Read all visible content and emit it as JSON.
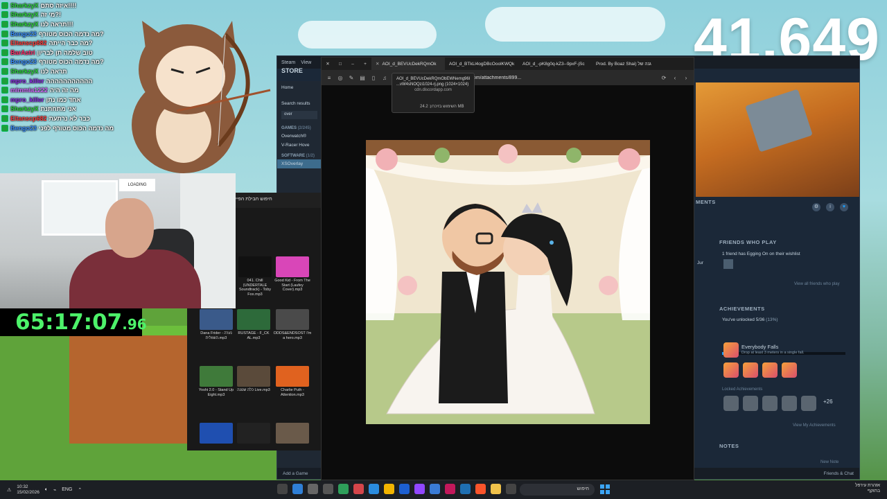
{
  "viewer_count": "41,649",
  "timer": {
    "main": "65:17:07",
    "fraction": ".96"
  },
  "chat": [
    {
      "user": "SharkzyX",
      "color": "#2bd63a",
      "msg": "איזה סתם!!!!"
    },
    {
      "user": "SharkzyX",
      "color": "#2bd63a",
      "msg": "מי זה?!"
    },
    {
      "user": "SharkzyX",
      "color": "#2bd63a",
      "msg": "תראה לנו!!!"
    },
    {
      "user": "Bengo23",
      "color": "#3a8fff",
      "msg": "מה נדמה הכוס מטורף?"
    },
    {
      "user": "Eltanscp682",
      "color": "#ff3b3b",
      "msg": "מה כבר הייתה?"
    },
    {
      "user": "BarAstri",
      "color": "#ff2d6a",
      "msg": "טוב שלמה תן לבריון"
    },
    {
      "user": "Bengo23",
      "color": "#3a8fff",
      "msg": "מה נדמה הכוס מטורף?"
    },
    {
      "user": "SharkzyX",
      "color": "#2bd63a",
      "msg": "תראה לנו"
    },
    {
      "user": "mpro_killer",
      "color": "#8a2be2",
      "msg": "ההההההההההה"
    },
    {
      "user": "mimmia1222",
      "color": "#d36bff",
      "msg": "מה זה היה"
    },
    {
      "user": "mpro_killer",
      "color": "#8a2be2",
      "msg": "אחד כמו נתן"
    },
    {
      "user": "SharkzyX",
      "color": "#2bd63a",
      "msg": "אני מתחתנת"
    },
    {
      "user": "Eltanscp682",
      "color": "#ff3b3b",
      "msg": "כבר לא נרתעת"
    },
    {
      "user": "Bengo23",
      "color": "#3a8fff",
      "msg": "מה נדמה הכוס מטורף לפני"
    }
  ],
  "webcam": {
    "sign": "LOADING"
  },
  "steam": {
    "title_items": [
      "Steam",
      "View"
    ],
    "store_label": "STORE",
    "nav_home": "Home",
    "search_results": "Search results",
    "search_value": "over",
    "games_header": "GAMES",
    "games_count": "(2/245)",
    "games": [
      "Overwatch®",
      "V-Racer Hove"
    ],
    "software_header": "SOFTWARE",
    "software_count": "(1/2)",
    "software": [
      "XSOverlay"
    ],
    "add_game": "Add a Game",
    "friends_chat": "Friends & Chat",
    "achievements_tab": "MENTS",
    "friends_header": "FRIENDS WHO PLAY",
    "friends_line": "1 friend has Egging On on their wishlist",
    "friends_link": "View all friends who play",
    "ach_header": "ACHIEVEMENTS",
    "ach_unlocked": "You've unlocked 5/36",
    "ach_percent": "(13%)",
    "ach_progress": 0.13,
    "ach_name": "Everybody Falls",
    "ach_desc": "Drop at least 3 meters in a single fall.",
    "locked_label": "Locked Achievements",
    "locked_more": "+26",
    "ach_link": "View My Achievements",
    "notes_header": "NOTES",
    "notes_link": "New Note",
    "side_text": [
      "Jur",
      "Jur"
    ]
  },
  "explorer": {
    "title": "חיפוש חבילת הפיי",
    "tiles": [
      {
        "label": "041. Chill (UNDERTALE Soundtrack) - Toby Fox.mp3",
        "color": "#111111"
      },
      {
        "label": "Good Kid - From The Start (Laufey Cover).mp3",
        "color": "#d946b8"
      },
      {
        "label": "Dana Frider - נערה השוולית.mp3",
        "color": "#3a5a8a"
      },
      {
        "label": "RUSTAGE - F_CK AL.mp3",
        "color": "#2d6a3a"
      },
      {
        "label": "ODDS&ENDSOST I'm a hero.mp3",
        "color": "#4a4a4a"
      },
      {
        "label": "Yoshi 2.0 - Stand Up Eight.mp3",
        "color": "#3f7a3a"
      },
      {
        "label": "כלה שנונה Live.mp3",
        "color": "#5a4a3a"
      },
      {
        "label": "Charlie Puth - Attention.mp3",
        "color": "#e0621f"
      },
      {
        "label": "",
        "color": "#1f4fb0"
      },
      {
        "label": "",
        "color": "#222222"
      },
      {
        "label": "",
        "color": "#6a5a4a"
      }
    ]
  },
  "browser": {
    "tabs": [
      {
        "label": "AOI_d_BEVUcDekRQmOk",
        "active": true
      },
      {
        "label": "AOI_d_BTkLl4ogDBcOoolKWQk",
        "active": false
      },
      {
        "label": "AOI_d_-pK8g0q-kZ3--9pxF-jSc",
        "active": false
      },
      {
        "label": "Prod. By Boaz Shai) גנה של",
        "active": false
      }
    ],
    "url": "cdn.discordapp.com/attachments/899...",
    "tooltip": {
      "line1": "AOI_d_BEVUcDekRQmObEWNemg96I",
      "line2": "...vW4sNOQzi1024-rj.png (1024×1024)",
      "host": "cdn.discordapp.com",
      "memory": "השימוש בזיכרון: 24.2 MB"
    }
  },
  "taskbar": {
    "time": "10:32",
    "date": "15/02/2026",
    "lang": "ENG",
    "search": "חיפוש",
    "user_line1": "אזהרת עירפל",
    "user_line2": "בתוקף"
  }
}
